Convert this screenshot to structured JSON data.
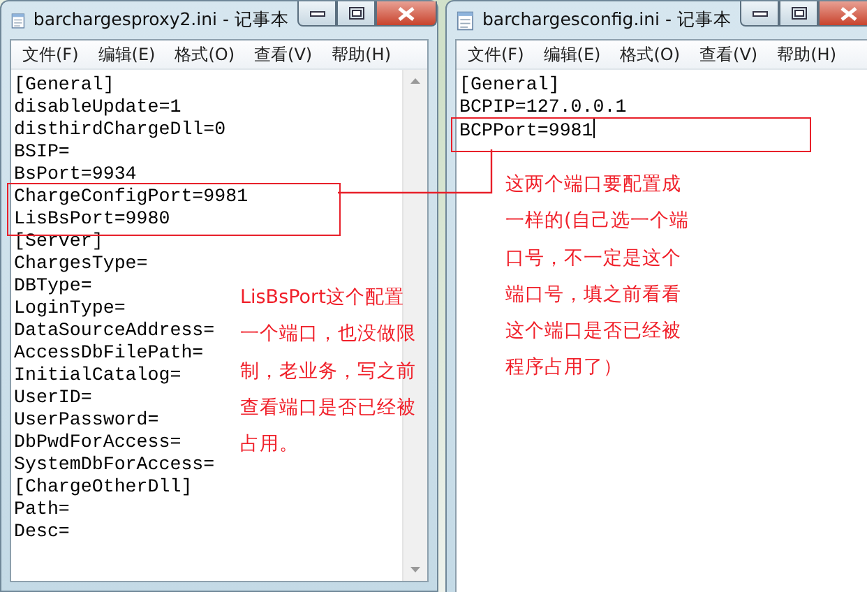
{
  "windows": [
    {
      "title": "barchargesproxy2.ini - 记事本",
      "menu": [
        "文件(F)",
        "编辑(E)",
        "格式(O)",
        "查看(V)",
        "帮助(H)"
      ],
      "caret": false,
      "lines": [
        "[General]",
        "disableUpdate=1",
        "disthirdChargeDll=0",
        "BSIP=",
        "BsPort=9934",
        "ChargeConfigPort=9981",
        "LisBsPort=9980",
        "[Server]",
        "ChargesType=",
        "DBType=",
        "LoginType=",
        "DataSourceAddress=",
        "AccessDbFilePath=",
        "InitialCatalog=",
        "UserID=",
        "UserPassword=",
        "DbPwdForAccess=",
        "SystemDbForAccess=",
        "[ChargeOtherDll]",
        "Path=",
        "Desc="
      ]
    },
    {
      "title": "barchargesconfig.ini - 记事本",
      "menu": [
        "文件(F)",
        "编辑(E)",
        "格式(O)",
        "查看(V)",
        "帮助(H)"
      ],
      "caret": true,
      "lines": [
        "[General]",
        "BCPIP=127.0.0.1",
        "BCPPort=9981"
      ]
    }
  ],
  "notes": [
    {
      "lines": [
        "LisBsPort这个配置",
        "一个端口，也没做限",
        "制，老业务，写之前",
        "查看端口是否已经被",
        "占用。"
      ]
    },
    {
      "lines": [
        "这两个端口要配置成",
        "一样的(自己选一个端",
        "口号，不一定是这个",
        "端口号，填之前看看",
        "这个端口是否已经被",
        "程序占用了）"
      ]
    }
  ]
}
